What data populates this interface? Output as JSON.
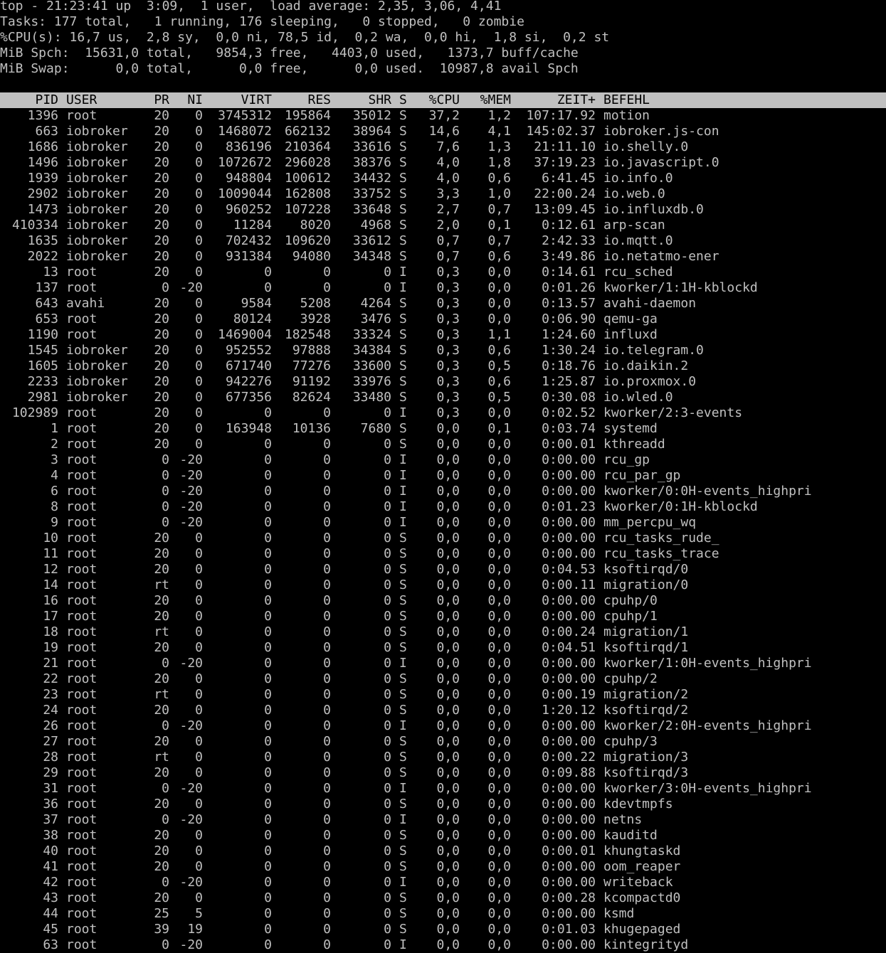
{
  "theme": {
    "background": "#000000",
    "foreground": "#c0c0c0",
    "header_background": "#c0c0c0",
    "header_foreground": "#000000"
  },
  "summary": {
    "uptime": "top - 21:23:41 up  3:09,  1 user,  load average: 2,35, 3,06, 4,41",
    "tasks": "Tasks: 177 total,   1 running, 176 sleeping,   0 stopped,   0 zombie",
    "cpu": "%CPU(s): 16,7 us,  2,8 sy,  0,0 ni, 78,5 id,  0,2 wa,  0,0 hi,  1,8 si,  0,2 st",
    "mem": "MiB Spch:  15631,0 total,   9854,3 free,   4403,0 used,   1373,7 buff/cache",
    "swap": "MiB Swap:      0,0 total,      0,0 free,      0,0 used.  10987,8 avail Spch"
  },
  "columns": [
    "PID",
    "USER",
    "PR",
    "NI",
    "VIRT",
    "RES",
    "SHR",
    "S",
    "%CPU",
    "%MEM",
    "ZEIT+",
    "BEFEHL"
  ],
  "processes": [
    [
      "1396",
      "root",
      "20",
      "0",
      "3745312",
      "195864",
      "35012",
      "S",
      "37,2",
      "1,2",
      "107:17.92",
      "motion"
    ],
    [
      "663",
      "iobroker",
      "20",
      "0",
      "1468072",
      "662132",
      "38964",
      "S",
      "14,6",
      "4,1",
      "145:02.37",
      "iobroker.js-con"
    ],
    [
      "1686",
      "iobroker",
      "20",
      "0",
      "836196",
      "210364",
      "33616",
      "S",
      "7,6",
      "1,3",
      "21:11.10",
      "io.shelly.0"
    ],
    [
      "1496",
      "iobroker",
      "20",
      "0",
      "1072672",
      "296028",
      "38376",
      "S",
      "4,0",
      "1,8",
      "37:19.23",
      "io.javascript.0"
    ],
    [
      "1939",
      "iobroker",
      "20",
      "0",
      "948804",
      "100612",
      "34432",
      "S",
      "4,0",
      "0,6",
      "6:41.45",
      "io.info.0"
    ],
    [
      "2902",
      "iobroker",
      "20",
      "0",
      "1009044",
      "162808",
      "33752",
      "S",
      "3,3",
      "1,0",
      "22:00.24",
      "io.web.0"
    ],
    [
      "1473",
      "iobroker",
      "20",
      "0",
      "960252",
      "107228",
      "33648",
      "S",
      "2,7",
      "0,7",
      "13:09.45",
      "io.influxdb.0"
    ],
    [
      "410334",
      "iobroker",
      "20",
      "0",
      "11284",
      "8020",
      "4968",
      "S",
      "2,0",
      "0,1",
      "0:12.61",
      "arp-scan"
    ],
    [
      "1635",
      "iobroker",
      "20",
      "0",
      "702432",
      "109620",
      "33612",
      "S",
      "0,7",
      "0,7",
      "2:42.33",
      "io.mqtt.0"
    ],
    [
      "2022",
      "iobroker",
      "20",
      "0",
      "931384",
      "94080",
      "34348",
      "S",
      "0,7",
      "0,6",
      "3:49.86",
      "io.netatmo-ener"
    ],
    [
      "13",
      "root",
      "20",
      "0",
      "0",
      "0",
      "0",
      "I",
      "0,3",
      "0,0",
      "0:14.61",
      "rcu_sched"
    ],
    [
      "137",
      "root",
      "0",
      "-20",
      "0",
      "0",
      "0",
      "I",
      "0,3",
      "0,0",
      "0:01.26",
      "kworker/1:1H-kblockd"
    ],
    [
      "643",
      "avahi",
      "20",
      "0",
      "9584",
      "5208",
      "4264",
      "S",
      "0,3",
      "0,0",
      "0:13.57",
      "avahi-daemon"
    ],
    [
      "653",
      "root",
      "20",
      "0",
      "80124",
      "3928",
      "3476",
      "S",
      "0,3",
      "0,0",
      "0:06.90",
      "qemu-ga"
    ],
    [
      "1190",
      "root",
      "20",
      "0",
      "1469004",
      "182548",
      "33324",
      "S",
      "0,3",
      "1,1",
      "1:24.60",
      "influxd"
    ],
    [
      "1545",
      "iobroker",
      "20",
      "0",
      "952552",
      "97888",
      "34384",
      "S",
      "0,3",
      "0,6",
      "1:30.24",
      "io.telegram.0"
    ],
    [
      "1605",
      "iobroker",
      "20",
      "0",
      "671740",
      "77276",
      "33600",
      "S",
      "0,3",
      "0,5",
      "0:18.76",
      "io.daikin.2"
    ],
    [
      "2233",
      "iobroker",
      "20",
      "0",
      "942276",
      "91192",
      "33976",
      "S",
      "0,3",
      "0,6",
      "1:25.87",
      "io.proxmox.0"
    ],
    [
      "2981",
      "iobroker",
      "20",
      "0",
      "677356",
      "82624",
      "33480",
      "S",
      "0,3",
      "0,5",
      "0:30.08",
      "io.wled.0"
    ],
    [
      "102989",
      "root",
      "20",
      "0",
      "0",
      "0",
      "0",
      "I",
      "0,3",
      "0,0",
      "0:02.52",
      "kworker/2:3-events"
    ],
    [
      "1",
      "root",
      "20",
      "0",
      "163948",
      "10136",
      "7680",
      "S",
      "0,0",
      "0,1",
      "0:03.74",
      "systemd"
    ],
    [
      "2",
      "root",
      "20",
      "0",
      "0",
      "0",
      "0",
      "S",
      "0,0",
      "0,0",
      "0:00.01",
      "kthreadd"
    ],
    [
      "3",
      "root",
      "0",
      "-20",
      "0",
      "0",
      "0",
      "I",
      "0,0",
      "0,0",
      "0:00.00",
      "rcu_gp"
    ],
    [
      "4",
      "root",
      "0",
      "-20",
      "0",
      "0",
      "0",
      "I",
      "0,0",
      "0,0",
      "0:00.00",
      "rcu_par_gp"
    ],
    [
      "6",
      "root",
      "0",
      "-20",
      "0",
      "0",
      "0",
      "I",
      "0,0",
      "0,0",
      "0:00.00",
      "kworker/0:0H-events_highpri"
    ],
    [
      "8",
      "root",
      "0",
      "-20",
      "0",
      "0",
      "0",
      "I",
      "0,0",
      "0,0",
      "0:01.23",
      "kworker/0:1H-kblockd"
    ],
    [
      "9",
      "root",
      "0",
      "-20",
      "0",
      "0",
      "0",
      "I",
      "0,0",
      "0,0",
      "0:00.00",
      "mm_percpu_wq"
    ],
    [
      "10",
      "root",
      "20",
      "0",
      "0",
      "0",
      "0",
      "S",
      "0,0",
      "0,0",
      "0:00.00",
      "rcu_tasks_rude_"
    ],
    [
      "11",
      "root",
      "20",
      "0",
      "0",
      "0",
      "0",
      "S",
      "0,0",
      "0,0",
      "0:00.00",
      "rcu_tasks_trace"
    ],
    [
      "12",
      "root",
      "20",
      "0",
      "0",
      "0",
      "0",
      "S",
      "0,0",
      "0,0",
      "0:04.53",
      "ksoftirqd/0"
    ],
    [
      "14",
      "root",
      "rt",
      "0",
      "0",
      "0",
      "0",
      "S",
      "0,0",
      "0,0",
      "0:00.11",
      "migration/0"
    ],
    [
      "16",
      "root",
      "20",
      "0",
      "0",
      "0",
      "0",
      "S",
      "0,0",
      "0,0",
      "0:00.00",
      "cpuhp/0"
    ],
    [
      "17",
      "root",
      "20",
      "0",
      "0",
      "0",
      "0",
      "S",
      "0,0",
      "0,0",
      "0:00.00",
      "cpuhp/1"
    ],
    [
      "18",
      "root",
      "rt",
      "0",
      "0",
      "0",
      "0",
      "S",
      "0,0",
      "0,0",
      "0:00.24",
      "migration/1"
    ],
    [
      "19",
      "root",
      "20",
      "0",
      "0",
      "0",
      "0",
      "S",
      "0,0",
      "0,0",
      "0:04.51",
      "ksoftirqd/1"
    ],
    [
      "21",
      "root",
      "0",
      "-20",
      "0",
      "0",
      "0",
      "I",
      "0,0",
      "0,0",
      "0:00.00",
      "kworker/1:0H-events_highpri"
    ],
    [
      "22",
      "root",
      "20",
      "0",
      "0",
      "0",
      "0",
      "S",
      "0,0",
      "0,0",
      "0:00.00",
      "cpuhp/2"
    ],
    [
      "23",
      "root",
      "rt",
      "0",
      "0",
      "0",
      "0",
      "S",
      "0,0",
      "0,0",
      "0:00.19",
      "migration/2"
    ],
    [
      "24",
      "root",
      "20",
      "0",
      "0",
      "0",
      "0",
      "S",
      "0,0",
      "0,0",
      "1:20.12",
      "ksoftirqd/2"
    ],
    [
      "26",
      "root",
      "0",
      "-20",
      "0",
      "0",
      "0",
      "I",
      "0,0",
      "0,0",
      "0:00.00",
      "kworker/2:0H-events_highpri"
    ],
    [
      "27",
      "root",
      "20",
      "0",
      "0",
      "0",
      "0",
      "S",
      "0,0",
      "0,0",
      "0:00.00",
      "cpuhp/3"
    ],
    [
      "28",
      "root",
      "rt",
      "0",
      "0",
      "0",
      "0",
      "S",
      "0,0",
      "0,0",
      "0:00.22",
      "migration/3"
    ],
    [
      "29",
      "root",
      "20",
      "0",
      "0",
      "0",
      "0",
      "S",
      "0,0",
      "0,0",
      "0:09.88",
      "ksoftirqd/3"
    ],
    [
      "31",
      "root",
      "0",
      "-20",
      "0",
      "0",
      "0",
      "I",
      "0,0",
      "0,0",
      "0:00.00",
      "kworker/3:0H-events_highpri"
    ],
    [
      "36",
      "root",
      "20",
      "0",
      "0",
      "0",
      "0",
      "S",
      "0,0",
      "0,0",
      "0:00.00",
      "kdevtmpfs"
    ],
    [
      "37",
      "root",
      "0",
      "-20",
      "0",
      "0",
      "0",
      "I",
      "0,0",
      "0,0",
      "0:00.00",
      "netns"
    ],
    [
      "38",
      "root",
      "20",
      "0",
      "0",
      "0",
      "0",
      "S",
      "0,0",
      "0,0",
      "0:00.00",
      "kauditd"
    ],
    [
      "40",
      "root",
      "20",
      "0",
      "0",
      "0",
      "0",
      "S",
      "0,0",
      "0,0",
      "0:00.01",
      "khungtaskd"
    ],
    [
      "41",
      "root",
      "20",
      "0",
      "0",
      "0",
      "0",
      "S",
      "0,0",
      "0,0",
      "0:00.00",
      "oom_reaper"
    ],
    [
      "42",
      "root",
      "0",
      "-20",
      "0",
      "0",
      "0",
      "I",
      "0,0",
      "0,0",
      "0:00.00",
      "writeback"
    ],
    [
      "43",
      "root",
      "20",
      "0",
      "0",
      "0",
      "0",
      "S",
      "0,0",
      "0,0",
      "0:00.28",
      "kcompactd0"
    ],
    [
      "44",
      "root",
      "25",
      "5",
      "0",
      "0",
      "0",
      "S",
      "0,0",
      "0,0",
      "0:00.00",
      "ksmd"
    ],
    [
      "45",
      "root",
      "39",
      "19",
      "0",
      "0",
      "0",
      "S",
      "0,0",
      "0,0",
      "0:01.03",
      "khugepaged"
    ],
    [
      "63",
      "root",
      "0",
      "-20",
      "0",
      "0",
      "0",
      "I",
      "0,0",
      "0,0",
      "0:00.00",
      "kintegrityd"
    ]
  ]
}
